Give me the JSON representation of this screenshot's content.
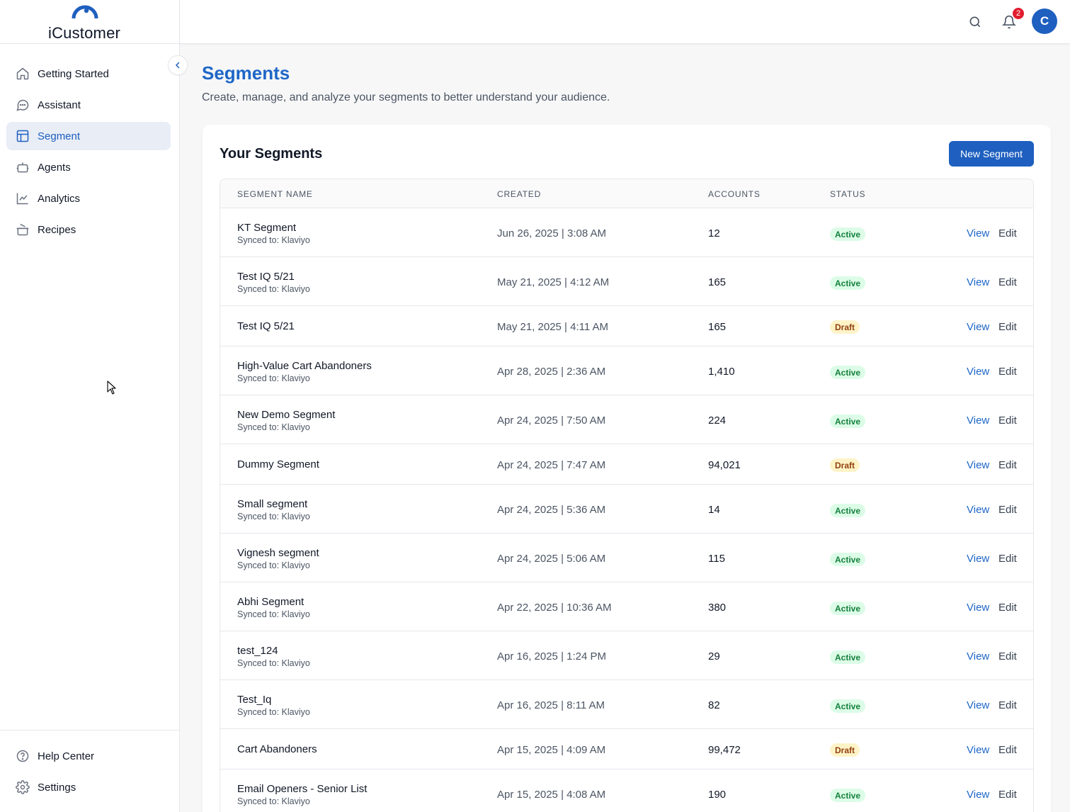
{
  "app": {
    "logo_text": "iCustomer"
  },
  "sidebar": {
    "collapse_icon": "chevron-left-icon",
    "items": [
      {
        "label": "Getting Started",
        "icon": "home-icon",
        "active": false
      },
      {
        "label": "Assistant",
        "icon": "chat-bubble-icon",
        "active": false
      },
      {
        "label": "Segment",
        "icon": "layout-icon",
        "active": true
      },
      {
        "label": "Agents",
        "icon": "bot-icon",
        "active": false
      },
      {
        "label": "Analytics",
        "icon": "line-chart-icon",
        "active": false
      },
      {
        "label": "Recipes",
        "icon": "cooking-pot-icon",
        "active": false
      }
    ],
    "bottom_items": [
      {
        "label": "Help Center",
        "icon": "help-circle-icon"
      },
      {
        "label": "Settings",
        "icon": "gear-icon"
      }
    ]
  },
  "topbar": {
    "notification_count": "2",
    "avatar_initial": "C"
  },
  "page": {
    "title": "Segments",
    "subtitle": "Create, manage, and analyze your segments to better understand your audience."
  },
  "card": {
    "title": "Your Segments",
    "new_button_label": "New Segment"
  },
  "table": {
    "headers": [
      "SEGMENT NAME",
      "CREATED",
      "ACCOUNTS",
      "STATUS"
    ],
    "action_view": "View",
    "action_edit": "Edit",
    "rows": [
      {
        "name": "KT Segment",
        "synced": "Synced to: Klaviyo",
        "created": "Jun 26, 2025 | 3:08 AM",
        "accounts": "12",
        "status": "Active"
      },
      {
        "name": "Test IQ 5/21",
        "synced": "Synced to: Klaviyo",
        "created": "May 21, 2025 | 4:12 AM",
        "accounts": "165",
        "status": "Active"
      },
      {
        "name": "Test IQ 5/21",
        "synced": "",
        "created": "May 21, 2025 | 4:11 AM",
        "accounts": "165",
        "status": "Draft"
      },
      {
        "name": "High-Value Cart Abandoners",
        "synced": "Synced to: Klaviyo",
        "created": "Apr 28, 2025 | 2:36 AM",
        "accounts": "1,410",
        "status": "Active"
      },
      {
        "name": "New Demo Segment",
        "synced": "Synced to: Klaviyo",
        "created": "Apr 24, 2025 | 7:50 AM",
        "accounts": "224",
        "status": "Active"
      },
      {
        "name": "Dummy Segment",
        "synced": "",
        "created": "Apr 24, 2025 | 7:47 AM",
        "accounts": "94,021",
        "status": "Draft"
      },
      {
        "name": "Small segment",
        "synced": "Synced to: Klaviyo",
        "created": "Apr 24, 2025 | 5:36 AM",
        "accounts": "14",
        "status": "Active"
      },
      {
        "name": "Vignesh segment",
        "synced": "Synced to: Klaviyo",
        "created": "Apr 24, 2025 | 5:06 AM",
        "accounts": "115",
        "status": "Active"
      },
      {
        "name": "Abhi Segment",
        "synced": "Synced to: Klaviyo",
        "created": "Apr 22, 2025 | 10:36 AM",
        "accounts": "380",
        "status": "Active"
      },
      {
        "name": "test_124",
        "synced": "Synced to: Klaviyo",
        "created": "Apr 16, 2025 | 1:24 PM",
        "accounts": "29",
        "status": "Active"
      },
      {
        "name": "Test_Iq",
        "synced": "Synced to: Klaviyo",
        "created": "Apr 16, 2025 | 8:11 AM",
        "accounts": "82",
        "status": "Active"
      },
      {
        "name": "Cart Abandoners",
        "synced": "",
        "created": "Apr 15, 2025 | 4:09 AM",
        "accounts": "99,472",
        "status": "Draft"
      },
      {
        "name": "Email Openers - Senior List",
        "synced": "Synced to: Klaviyo",
        "created": "Apr 15, 2025 | 4:08 AM",
        "accounts": "190",
        "status": "Active"
      }
    ]
  },
  "colors": {
    "brand_blue": "#1e5fbf",
    "active_badge_bg": "#dcfce7",
    "draft_badge_bg": "#fef3c7",
    "notification_badge": "#e11d2e"
  }
}
